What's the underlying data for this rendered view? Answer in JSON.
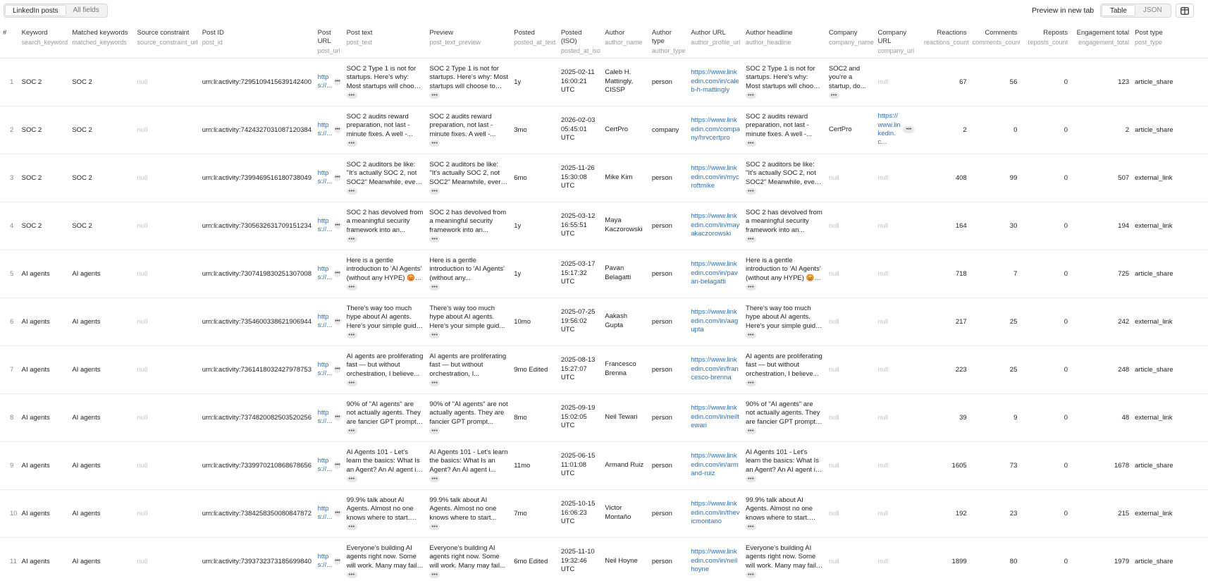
{
  "toolbar": {
    "tabs": [
      {
        "label": "LinkedIn posts",
        "active": true
      },
      {
        "label": "All fields",
        "active": false
      }
    ],
    "preview_label": "Preview in new tab",
    "view_tabs": [
      {
        "label": "Table",
        "active": true
      },
      {
        "label": "JSON",
        "active": false
      }
    ],
    "layout_icon": "columns-icon"
  },
  "columns": [
    {
      "label": "#",
      "key": ""
    },
    {
      "label": "Keyword",
      "key": "search_keyword"
    },
    {
      "label": "Matched keywords",
      "key": "matched_keywords"
    },
    {
      "label": "Source constraint",
      "key": "source_constraint_url"
    },
    {
      "label": "Post ID",
      "key": "post_id"
    },
    {
      "label": "Post URL",
      "key": "post_url"
    },
    {
      "label": "Post text",
      "key": "post_text"
    },
    {
      "label": "Preview",
      "key": "post_text_preview"
    },
    {
      "label": "Posted",
      "key": "posted_at_text"
    },
    {
      "label": "Posted (ISO)",
      "key": "posted_at_iso"
    },
    {
      "label": "Author",
      "key": "author_name"
    },
    {
      "label": "Author type",
      "key": "author_type"
    },
    {
      "label": "Author URL",
      "key": "author_profile_url"
    },
    {
      "label": "Author headline",
      "key": "author_headline"
    },
    {
      "label": "Company",
      "key": "company_name"
    },
    {
      "label": "Company URL",
      "key": "company_url"
    },
    {
      "label": "Reactions",
      "key": "reactions_count"
    },
    {
      "label": "Comments",
      "key": "comments_count"
    },
    {
      "label": "Reposts",
      "key": "reposts_count"
    },
    {
      "label": "Engagement total",
      "key": "engagement_total"
    },
    {
      "label": "Post type",
      "key": "post_type"
    }
  ],
  "rows": [
    {
      "idx": "1",
      "keyword": "SOC 2",
      "matched": "SOC 2",
      "source": "null",
      "post_id": "urn:li:activity:7295109415639142400",
      "post_url": "https://...",
      "post_text": "SOC 2 Type 1 is not for startups. Here's why: Most startups will choose to us...",
      "preview": "SOC 2 Type 1 is not for startups. Here's why: Most startups will choose to us...",
      "posted": "1y",
      "posted_iso": "2025-02-11 16:00:21 UTC",
      "author": "Caleb H. Mattingly, CISSP",
      "author_type": "person",
      "author_url": "https://www.linkedin.com/in/caleb-h-mattingly",
      "headline": "SOC 2 Type 1 is not for startups. Here's why: Most startups will choose to us...",
      "company": "SOC2 and you're a startup, do...",
      "company_url": "null",
      "reactions": "67",
      "comments": "56",
      "reposts": "0",
      "engagement": "123",
      "post_type": "article_share"
    },
    {
      "idx": "2",
      "keyword": "SOC 2",
      "matched": "SOC 2",
      "source": "null",
      "post_id": "urn:li:activity:7424327031087120384",
      "post_url": "https://...",
      "post_text": "SOC 2 audits reward preparation, not last - minute fixes. A well -...",
      "preview": "SOC 2 audits reward preparation, not last - minute fixes. A well -...",
      "posted": "3mo",
      "posted_iso": "2026-02-03 05:45:01 UTC",
      "author": "CertPro",
      "author_type": "company",
      "author_url": "https://www.linkedin.com/company/hrvcertpro",
      "headline": "SOC 2 audits reward preparation, not last - minute fixes. A well -...",
      "company": "CertPro",
      "company_url": "https://www.linkedin.c...",
      "reactions": "2",
      "comments": "0",
      "reposts": "0",
      "engagement": "2",
      "post_type": "article_share"
    },
    {
      "idx": "3",
      "keyword": "SOC 2",
      "matched": "SOC 2",
      "source": "null",
      "post_id": "urn:li:activity:7399469516180738049",
      "post_url": "https://...",
      "post_text": "SOC 2 auditors be like: \"It's actually SOC 2, not SOC2\" Meanwhile, every startup...",
      "preview": "SOC 2 auditors be like: \"It's actually SOC 2, not SOC2\" Meanwhile, every startup...",
      "posted": "6mo",
      "posted_iso": "2025-11-26 15:30:08 UTC",
      "author": "Mike Kim",
      "author_type": "person",
      "author_url": "https://www.linkedin.com/in/mycroftmike",
      "headline": "SOC 2 auditors be like: \"It's actually SOC 2, not SOC2\" Meanwhile, every startup...",
      "company": "null",
      "company_url": "null",
      "reactions": "408",
      "comments": "99",
      "reposts": "0",
      "engagement": "507",
      "post_type": "external_link"
    },
    {
      "idx": "4",
      "keyword": "SOC 2",
      "matched": "SOC 2",
      "source": "null",
      "post_id": "urn:li:activity:7305632631709151234",
      "post_url": "https://...",
      "post_text": "SOC 2 has devolved from a meaningful security framework into an...",
      "preview": "SOC 2 has devolved from a meaningful security framework into an...",
      "posted": "1y",
      "posted_iso": "2025-03-12 16:55:51 UTC",
      "author": "Maya Kaczorowski",
      "author_type": "person",
      "author_url": "https://www.linkedin.com/in/mayakaczorowski",
      "headline": "SOC 2 has devolved from a meaningful security framework into an...",
      "company": "null",
      "company_url": "null",
      "reactions": "164",
      "comments": "30",
      "reposts": "0",
      "engagement": "194",
      "post_type": "external_link"
    },
    {
      "idx": "5",
      "keyword": "AI agents",
      "matched": "AI agents",
      "source": "null",
      "post_id": "urn:li:activity:7307419830251307008",
      "post_url": "https://...",
      "post_text": "Here is a gentle introduction to 'AI Agents' (without any HYPE) 😡 An...",
      "preview": "Here is a gentle introduction to 'AI Agents' (without any...",
      "posted": "1y",
      "posted_iso": "2025-03-17 15:17:32 UTC",
      "author": "Pavan Belagatti",
      "author_type": "person",
      "author_url": "https://www.linkedin.com/in/pavan-belagatti",
      "headline": "Here is a gentle introduction to 'AI Agents' (without any HYPE) 😡 An...",
      "company": "null",
      "company_url": "null",
      "reactions": "718",
      "comments": "7",
      "reposts": "0",
      "engagement": "725",
      "post_type": "article_share"
    },
    {
      "idx": "6",
      "keyword": "AI agents",
      "matched": "AI agents",
      "source": "null",
      "post_id": "urn:li:activity:7354600338621906944",
      "post_url": "https://...",
      "post_text": "There's way too much hype about AI agents. Here's your simple guide: Forget...",
      "preview": "There's way too much hype about AI agents. Here's your simple guid...",
      "posted": "10mo",
      "posted_iso": "2025-07-25 19:56:02 UTC",
      "author": "Aakash Gupta",
      "author_type": "person",
      "author_url": "https://www.linkedin.com/in/aagupta",
      "headline": "There's way too much hype about AI agents. Here's your simple guide: Forget...",
      "company": "null",
      "company_url": "null",
      "reactions": "217",
      "comments": "25",
      "reposts": "0",
      "engagement": "242",
      "post_type": "external_link"
    },
    {
      "idx": "7",
      "keyword": "AI agents",
      "matched": "AI agents",
      "source": "null",
      "post_id": "urn:li:activity:7361418032427978753",
      "post_url": "https://...",
      "post_text": "AI agents are proliferating fast — but without orchestration, I believe...",
      "preview": "AI agents are proliferating fast — but without orchestration, I...",
      "posted": "9mo Edited",
      "posted_iso": "2025-08-13 15:27:07 UTC",
      "author": "Francesco Brenna",
      "author_type": "person",
      "author_url": "https://www.linkedin.com/in/francesco-brenna",
      "headline": "AI agents are proliferating fast — but without orchestration, I believe...",
      "company": "null",
      "company_url": "null",
      "reactions": "223",
      "comments": "25",
      "reposts": "0",
      "engagement": "248",
      "post_type": "article_share"
    },
    {
      "idx": "8",
      "keyword": "AI agents",
      "matched": "AI agents",
      "source": "null",
      "post_id": "urn:li:activity:7374820082503520256",
      "post_url": "https://...",
      "post_text": "90% of \"AI agents\" are not actually agents. They are fancier GPT prompts and...",
      "preview": "90% of \"AI agents\" are not actually agents. They are fancier GPT prompt...",
      "posted": "8mo",
      "posted_iso": "2025-09-19 15:02:05 UTC",
      "author": "Neil Tewari",
      "author_type": "person",
      "author_url": "https://www.linkedin.com/in/neiltewari",
      "headline": "90% of \"AI agents\" are not actually agents. They are fancier GPT prompts and...",
      "company": "null",
      "company_url": "null",
      "reactions": "39",
      "comments": "9",
      "reposts": "0",
      "engagement": "48",
      "post_type": "external_link"
    },
    {
      "idx": "9",
      "keyword": "AI agents",
      "matched": "AI agents",
      "source": "null",
      "post_id": "urn:li:activity:7339970210868678656",
      "post_url": "https://...",
      "post_text": "AI Agents 101 - Let's learn the basics: What Is an Agent? An AI agent is a...",
      "preview": "AI Agents 101 - Let's learn the basics: What Is an Agent? An AI agent i...",
      "posted": "11mo",
      "posted_iso": "2025-06-15 11:01:08 UTC",
      "author": "Armand Ruiz",
      "author_type": "person",
      "author_url": "https://www.linkedin.com/in/armand-ruiz",
      "headline": "AI Agents 101 - Let's learn the basics: What Is an Agent? An AI agent is a...",
      "company": "null",
      "company_url": "null",
      "reactions": "1605",
      "comments": "73",
      "reposts": "0",
      "engagement": "1678",
      "post_type": "article_share"
    },
    {
      "idx": "10",
      "keyword": "AI agents",
      "matched": "AI agents",
      "source": "null",
      "post_id": "urn:li:activity:7384258350080847872",
      "post_url": "https://...",
      "post_text": "99.9% talk about AI Agents. Almost no one knows where to start. This is...",
      "preview": "99.9% talk about AI Agents. Almost no one knows where to start...",
      "posted": "7mo",
      "posted_iso": "2025-10-15 16:06:23 UTC",
      "author": "Victor Montaño",
      "author_type": "person",
      "author_url": "https://www.linkedin.com/in/thevicmontano",
      "headline": "99.9% talk about AI Agents. Almost no one knows where to start. This is...",
      "company": "null",
      "company_url": "null",
      "reactions": "192",
      "comments": "23",
      "reposts": "0",
      "engagement": "215",
      "post_type": "external_link"
    },
    {
      "idx": "11",
      "keyword": "AI agents",
      "matched": "AI agents",
      "source": "null",
      "post_id": "urn:li:activity:7393732373185699840",
      "post_url": "https://...",
      "post_text": "Everyone's building AI agents right now. Some will work. Many may fail. The...",
      "preview": "Everyone's building AI agents right now. Some will work. Many may fail...",
      "posted": "6mo Edited",
      "posted_iso": "2025-11-10 19:32:46 UTC",
      "author": "Neil Hoyne",
      "author_type": "person",
      "author_url": "https://www.linkedin.com/in/neilhoyne",
      "headline": "Everyone's building AI agents right now. Some will work. Many may fail. The...",
      "company": "null",
      "company_url": "null",
      "reactions": "1899",
      "comments": "80",
      "reposts": "0",
      "engagement": "1979",
      "post_type": "article_share"
    }
  ]
}
